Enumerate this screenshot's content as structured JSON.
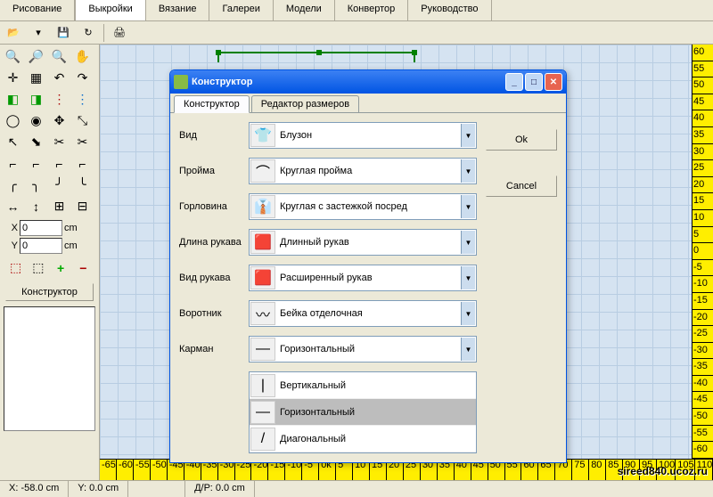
{
  "menu": {
    "items": [
      "Рисование",
      "Выкройки",
      "Вязание",
      "Галереи",
      "Модели",
      "Конвертор",
      "Руководство"
    ],
    "active": 1
  },
  "sidebar": {
    "coord_x_label": "X",
    "coord_y_label": "Y",
    "coord_x_value": "0",
    "coord_y_value": "0",
    "coord_unit": "cm",
    "constructor_btn": "Конструктор"
  },
  "dialog": {
    "title": "Конструктор",
    "tabs": [
      "Конструктор",
      "Редактор размеров"
    ],
    "active_tab": 0,
    "ok": "Ok",
    "cancel": "Cancel",
    "fields": [
      {
        "label": "Вид",
        "value": "Блузон",
        "icon": "👕"
      },
      {
        "label": "Пройма",
        "value": "Круглая пройма",
        "icon": "⌒"
      },
      {
        "label": "Горловина",
        "value": "Круглая с застежкой посред",
        "icon": "👔"
      },
      {
        "label": "Длина рукава",
        "value": "Длинный рукав",
        "icon": "🟥"
      },
      {
        "label": "Вид рукава",
        "value": "Расширенный рукав",
        "icon": "🟥"
      },
      {
        "label": "Воротник",
        "value": "Бейка отделочная",
        "icon": "〰"
      },
      {
        "label": "Карман",
        "value": "Горизонтальный",
        "icon": "—"
      }
    ],
    "dropdown_items": [
      {
        "label": "Вертикальный",
        "icon": "|"
      },
      {
        "label": "Горизонтальный",
        "icon": "—",
        "selected": true
      },
      {
        "label": "Диагональный",
        "icon": "/"
      }
    ]
  },
  "ruler_h": [
    "-65",
    "-60",
    "-55",
    "-50",
    "-45",
    "-40",
    "-35",
    "-30",
    "-25",
    "-20",
    "-15",
    "-10",
    "-5",
    "0k",
    "5",
    "10",
    "15",
    "20",
    "25",
    "30",
    "35",
    "40",
    "45",
    "50",
    "55",
    "60",
    "65",
    "70",
    "75",
    "80",
    "85",
    "90",
    "95",
    "100",
    "105",
    "110"
  ],
  "ruler_v": [
    "60",
    "55",
    "50",
    "45",
    "40",
    "35",
    "30",
    "25",
    "20",
    "15",
    "10",
    "5",
    "0",
    "-5",
    "-10",
    "-15",
    "-20",
    "-25",
    "-30",
    "-35",
    "-40",
    "-45",
    "-50",
    "-55",
    "-60"
  ],
  "status": {
    "x": "X: -58.0 cm",
    "y": "Y: 0.0 cm",
    "dp": "Д/Р: 0.0 cm"
  },
  "watermark": "sireed840.ucoz.ru"
}
